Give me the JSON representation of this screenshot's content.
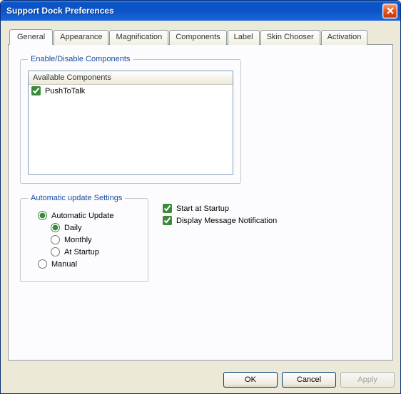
{
  "window": {
    "title": "Support Dock Preferences"
  },
  "tabs": {
    "general": "General",
    "appearance": "Appearance",
    "magnification": "Magnification",
    "components": "Components",
    "label": "Label",
    "skin": "Skin Chooser",
    "activation": "Activation"
  },
  "componentsGroup": {
    "legend": "Enable/Disable Components",
    "header": "Available Components",
    "items": [
      {
        "label": "PushToTalk",
        "checked": true
      }
    ]
  },
  "autoUpdate": {
    "legend": "Automatic update Settings",
    "automatic": "Automatic Update",
    "daily": "Daily",
    "monthly": "Monthly",
    "atStartup": "At Startup",
    "manual": "Manual"
  },
  "options": {
    "startAtStartup": "Start at Startup",
    "displayMsg": "Display Message Notification"
  },
  "buttons": {
    "ok": "OK",
    "cancel": "Cancel",
    "apply": "Apply"
  }
}
